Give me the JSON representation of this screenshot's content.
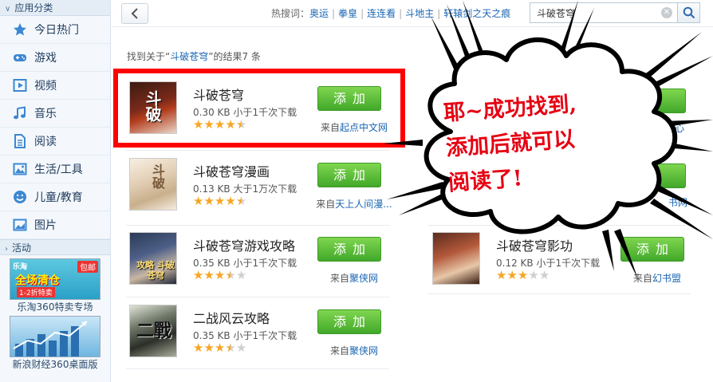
{
  "sidebar": {
    "header_apps": "应用分类",
    "items": [
      {
        "label": "今日热门",
        "icon": "star-icon"
      },
      {
        "label": "游戏",
        "icon": "gamepad-icon"
      },
      {
        "label": "视频",
        "icon": "video-icon"
      },
      {
        "label": "音乐",
        "icon": "music-icon"
      },
      {
        "label": "阅读",
        "icon": "document-icon"
      },
      {
        "label": "生活/工具",
        "icon": "picture-tool-icon"
      },
      {
        "label": "儿童/教育",
        "icon": "smiley-icon"
      },
      {
        "label": "图片",
        "icon": "image-icon"
      }
    ],
    "header_activity": "活动",
    "promos": [
      {
        "caption": "乐淘360特卖专场",
        "brand": "乐淘",
        "tag": "包邮",
        "big": "全场清仓",
        "small": "1-2折特卖"
      },
      {
        "caption": "新浪财经360桌面版"
      }
    ]
  },
  "topbar": {
    "hot_label": "热搜词：",
    "hot_words": [
      "奥运",
      "拳皇",
      "连连看",
      "斗地主",
      "轩辕剑之天之痕"
    ],
    "search_value": "斗破苍穹"
  },
  "results": {
    "prefix": "找到关于“",
    "keyword": "斗破苍穹",
    "suffix": "”的结果7 条"
  },
  "add_label": "添加",
  "source_prefix": "来自",
  "apps": [
    {
      "name": "斗破苍穹",
      "meta": "0.30 KB 小于1千次下载",
      "rating": 4.5,
      "source": "起点中文网",
      "cover_text": "斗破"
    },
    {
      "name": "斗破苍穹漫画",
      "meta": "0.13 KB 大于1万次下载",
      "rating": 4.5,
      "source": "天上人间漫...",
      "cover_text": "斗破"
    },
    {
      "name": "斗破苍穹游戏攻略",
      "meta": "0.35 KB 小于1千次下载",
      "rating": 3.5,
      "source": "聚侠网",
      "cover_text": "攻略 斗破苍穹"
    },
    {
      "name": "二战风云攻略",
      "meta": "0.35 KB 小于1千次下载",
      "rating": 3.5,
      "source": "聚侠网",
      "cover_text": "二戰"
    },
    {
      "name": "斗破苍穹影功",
      "meta": "0.12 KB 小于1千次下载",
      "rating": 3,
      "source": "幻书盟"
    }
  ],
  "partial_right": {
    "source_1_tail": "心",
    "source_2_tail": "书网"
  },
  "callout": {
    "line1": "耶~成功找到,",
    "line2": "添加后就可以",
    "line3": "阅读了!"
  },
  "colors": {
    "highlight": "#ff0000",
    "callout_text": "#e60012",
    "add_button": "#4fb72f",
    "link": "#1a66b3"
  }
}
